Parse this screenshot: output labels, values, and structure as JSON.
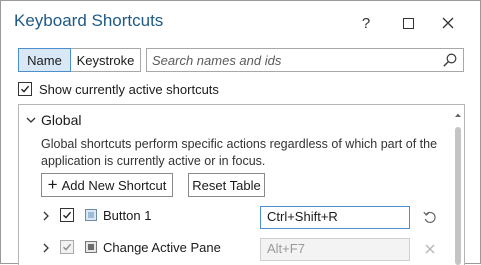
{
  "window": {
    "title": "Keyboard Shortcuts",
    "help_label": "?",
    "close_label": "✕"
  },
  "filter": {
    "name_label": "Name",
    "keystroke_label": "Keystroke",
    "selected": "Name"
  },
  "search": {
    "placeholder": "Search names and ids",
    "icon": "search-icon"
  },
  "show_active": {
    "label": "Show currently active shortcuts",
    "checked": true
  },
  "group": {
    "title": "Global",
    "expanded": true,
    "description": "Global shortcuts perform specific actions regardless of which part of the application is currently active or in focus.",
    "add_label": "Add New Shortcut",
    "reset_label": "Reset Table"
  },
  "shortcuts": [
    {
      "name": "Button 1",
      "keys": "Ctrl+Shift+R",
      "enabled": true,
      "action_icon": "reset-icon"
    },
    {
      "name": "Change Active Pane",
      "keys": "Alt+F7",
      "enabled": false,
      "action_icon": "clear-icon"
    }
  ],
  "colors": {
    "title": "#1f5a86",
    "accent": "#4d8fcc",
    "selected_bg": "#d8e8f6"
  }
}
